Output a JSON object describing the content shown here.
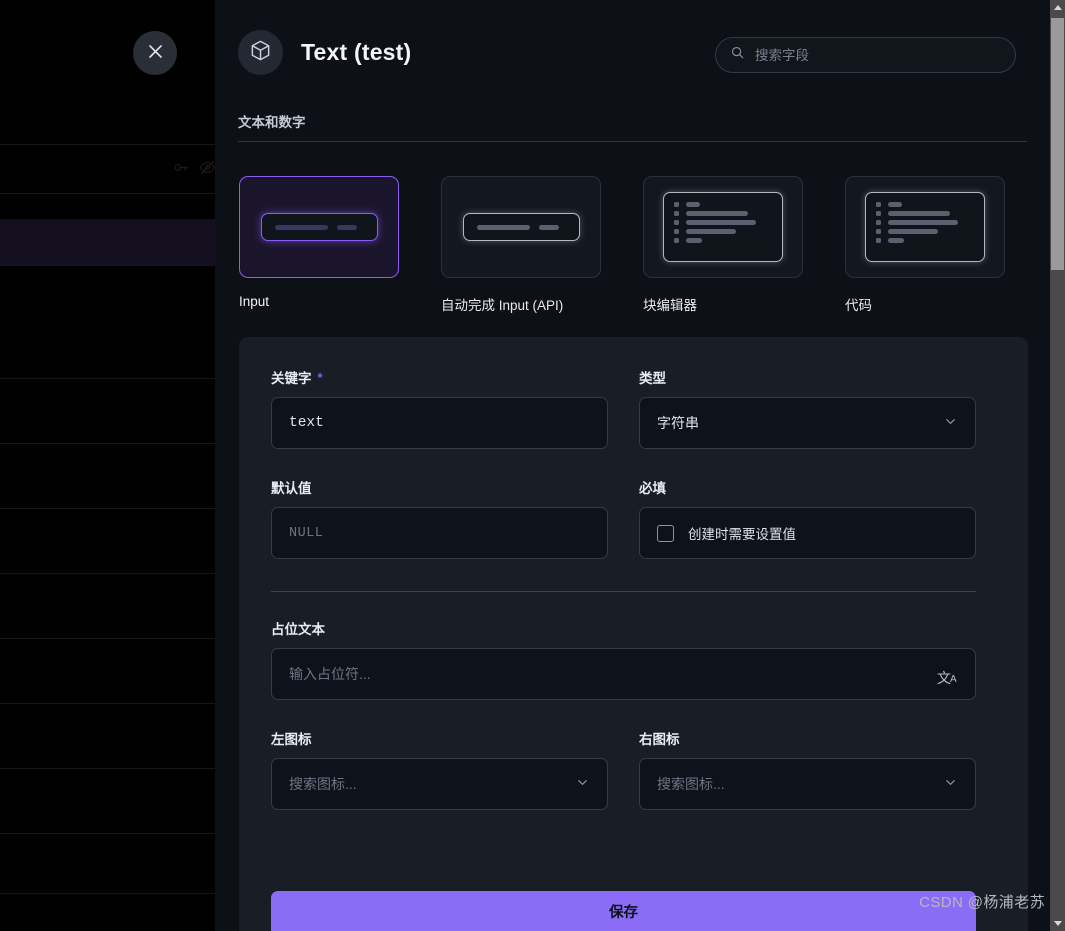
{
  "window": {
    "close_label": "×"
  },
  "panel": {
    "icon": "cube-icon",
    "title": "Text (test)",
    "search": {
      "icon": "search-icon",
      "placeholder": "搜索字段",
      "value": ""
    },
    "section": {
      "label": "文本和数字"
    }
  },
  "type_cards": [
    {
      "label": "Input",
      "art": "input",
      "selected": true
    },
    {
      "label": "自动完成 Input (API)",
      "art": "input",
      "selected": false
    },
    {
      "label": "块编辑器",
      "art": "list",
      "selected": false
    },
    {
      "label": "代码",
      "art": "list",
      "selected": false
    }
  ],
  "form": {
    "keyword": {
      "label": "关键字",
      "required_marker": "*",
      "value": "text"
    },
    "type": {
      "label": "类型",
      "value": "字符串",
      "chevron": "chevron-down-icon"
    },
    "default_value": {
      "label": "默认值",
      "placeholder": "NULL",
      "value": ""
    },
    "required": {
      "label": "必填",
      "checkbox_label": "创建时需要设置值",
      "checked": false
    },
    "placeholder_text": {
      "label": "占位文本",
      "placeholder": "输入占位符...",
      "value": "",
      "translate_icon": {
        "glyph_cn": "文",
        "glyph_a": "A"
      }
    },
    "left_icon": {
      "label": "左图标",
      "placeholder": "搜索图标...",
      "value": "",
      "chevron": "chevron-down-icon"
    },
    "right_icon": {
      "label": "右图标",
      "placeholder": "搜索图标...",
      "value": "",
      "chevron": "chevron-down-icon"
    },
    "save_label": "保存"
  },
  "watermark": "CSDN @杨浦老苏",
  "colors": {
    "accent": "#8b5cf6",
    "save_button": "#8b6cf6",
    "panel_bg": "#0d1117",
    "card_bg": "#181d26",
    "input_bg": "#0e131b"
  }
}
